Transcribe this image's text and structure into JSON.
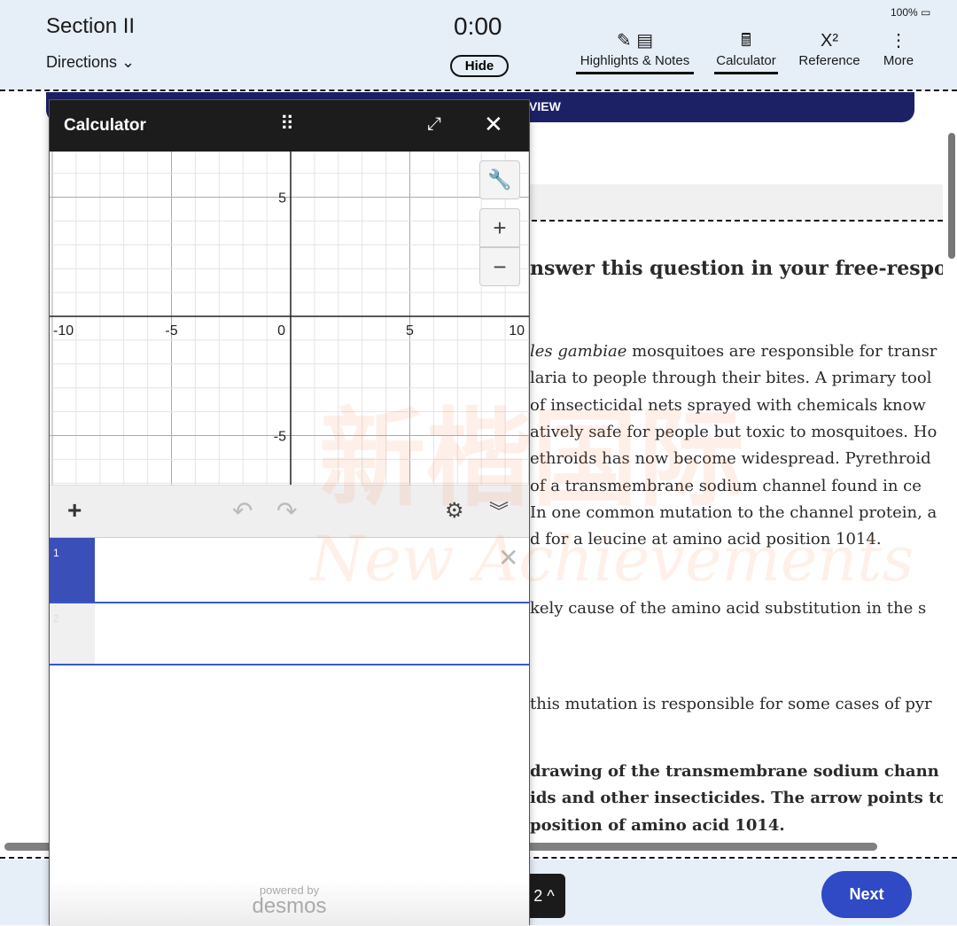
{
  "header": {
    "section": "Section II",
    "directions": "Directions",
    "timer": "0:00",
    "hide": "Hide",
    "battery": "100%",
    "tools": [
      {
        "label": "Highlights & Notes",
        "icon": "highlight-notes-icon",
        "glyph": "✎ ▤",
        "active": true
      },
      {
        "label": "Calculator",
        "icon": "calculator-icon",
        "glyph": "🖩",
        "active": true
      },
      {
        "label": "Reference",
        "icon": "reference-icon",
        "glyph": "X²",
        "active": false
      },
      {
        "label": "More",
        "icon": "more-vertical-icon",
        "glyph": "⋮",
        "active": false
      }
    ]
  },
  "banner": {
    "text": "VIEW"
  },
  "question": {
    "heading": "nswer this question in your free-respo",
    "para1": [
      "les gambiae mosquitoes are responsible for transr",
      "laria to people through their bites. A primary tool",
      " of insecticidal nets sprayed with chemicals know",
      "atively safe for people but toxic to mosquitoes. Ho",
      "ethroids has now become widespread. Pyrethroid",
      " of a transmembrane sodium channel found in ce",
      "In one common mutation to the channel protein, a",
      "d for a leucine at amino acid position 1014."
    ],
    "italic_prefix": "les gambiae",
    "line2": "kely cause of the amino acid substitution in the s",
    "line3": "this mutation is responsible for some cases of pyr",
    "bold": [
      " drawing of the transmembrane sodium chann",
      "ids and other insecticides. The arrow points to",
      " position of amino acid 1014."
    ]
  },
  "calculator": {
    "title": "Calculator",
    "x_ticks": [
      "-10",
      "-5",
      "0",
      "5",
      "10"
    ],
    "y_ticks": [
      "5",
      "-5"
    ],
    "xlim": [
      -10,
      10
    ],
    "ylim": [
      -7,
      7
    ],
    "expressions": [
      {
        "index": "1",
        "value": ""
      },
      {
        "index": "2",
        "value": ""
      }
    ],
    "powered_by": "powered by",
    "brand": "desmos",
    "accent": "#3b4fb8"
  },
  "footer": {
    "question_nav": "2 ^",
    "next": "Next"
  },
  "watermark": {
    "cn": "新楷国际",
    "en": "New Achievements"
  }
}
